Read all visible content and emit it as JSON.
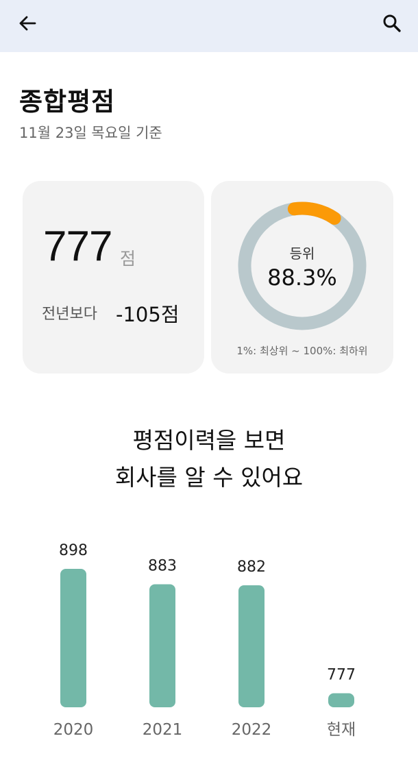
{
  "appbar": {
    "back_icon": "arrow-left-icon",
    "search_icon": "search-icon",
    "background": "#e9eef8"
  },
  "header": {
    "title": "종합평점",
    "subtitle": "11월 23일  목요일 기준"
  },
  "score_card": {
    "score": "777",
    "unit": "점",
    "diff_label": "전년보다",
    "diff_value": "-105점"
  },
  "rank_card": {
    "label": "등위",
    "value": "88.3%",
    "legend": "1%: 최상위 ~ 100%: 최하위",
    "ring_track_color": "#b9c8cc",
    "ring_fill_color": "#fb9a07",
    "ring_fill_fraction": 0.117
  },
  "history": {
    "title_line1": "평점이력을 보면",
    "title_line2": "회사를 알 수 있어요"
  },
  "chart_data": {
    "type": "bar",
    "categories": [
      "2020",
      "2021",
      "2022",
      "현재"
    ],
    "values": [
      898,
      883,
      882,
      777
    ],
    "value_labels": [
      "898",
      "883",
      "882",
      "777"
    ],
    "title": "",
    "xlabel": "",
    "ylabel": "",
    "ylim": [
      774,
      898
    ],
    "bar_color": "#73b8a8",
    "grid": false
  }
}
